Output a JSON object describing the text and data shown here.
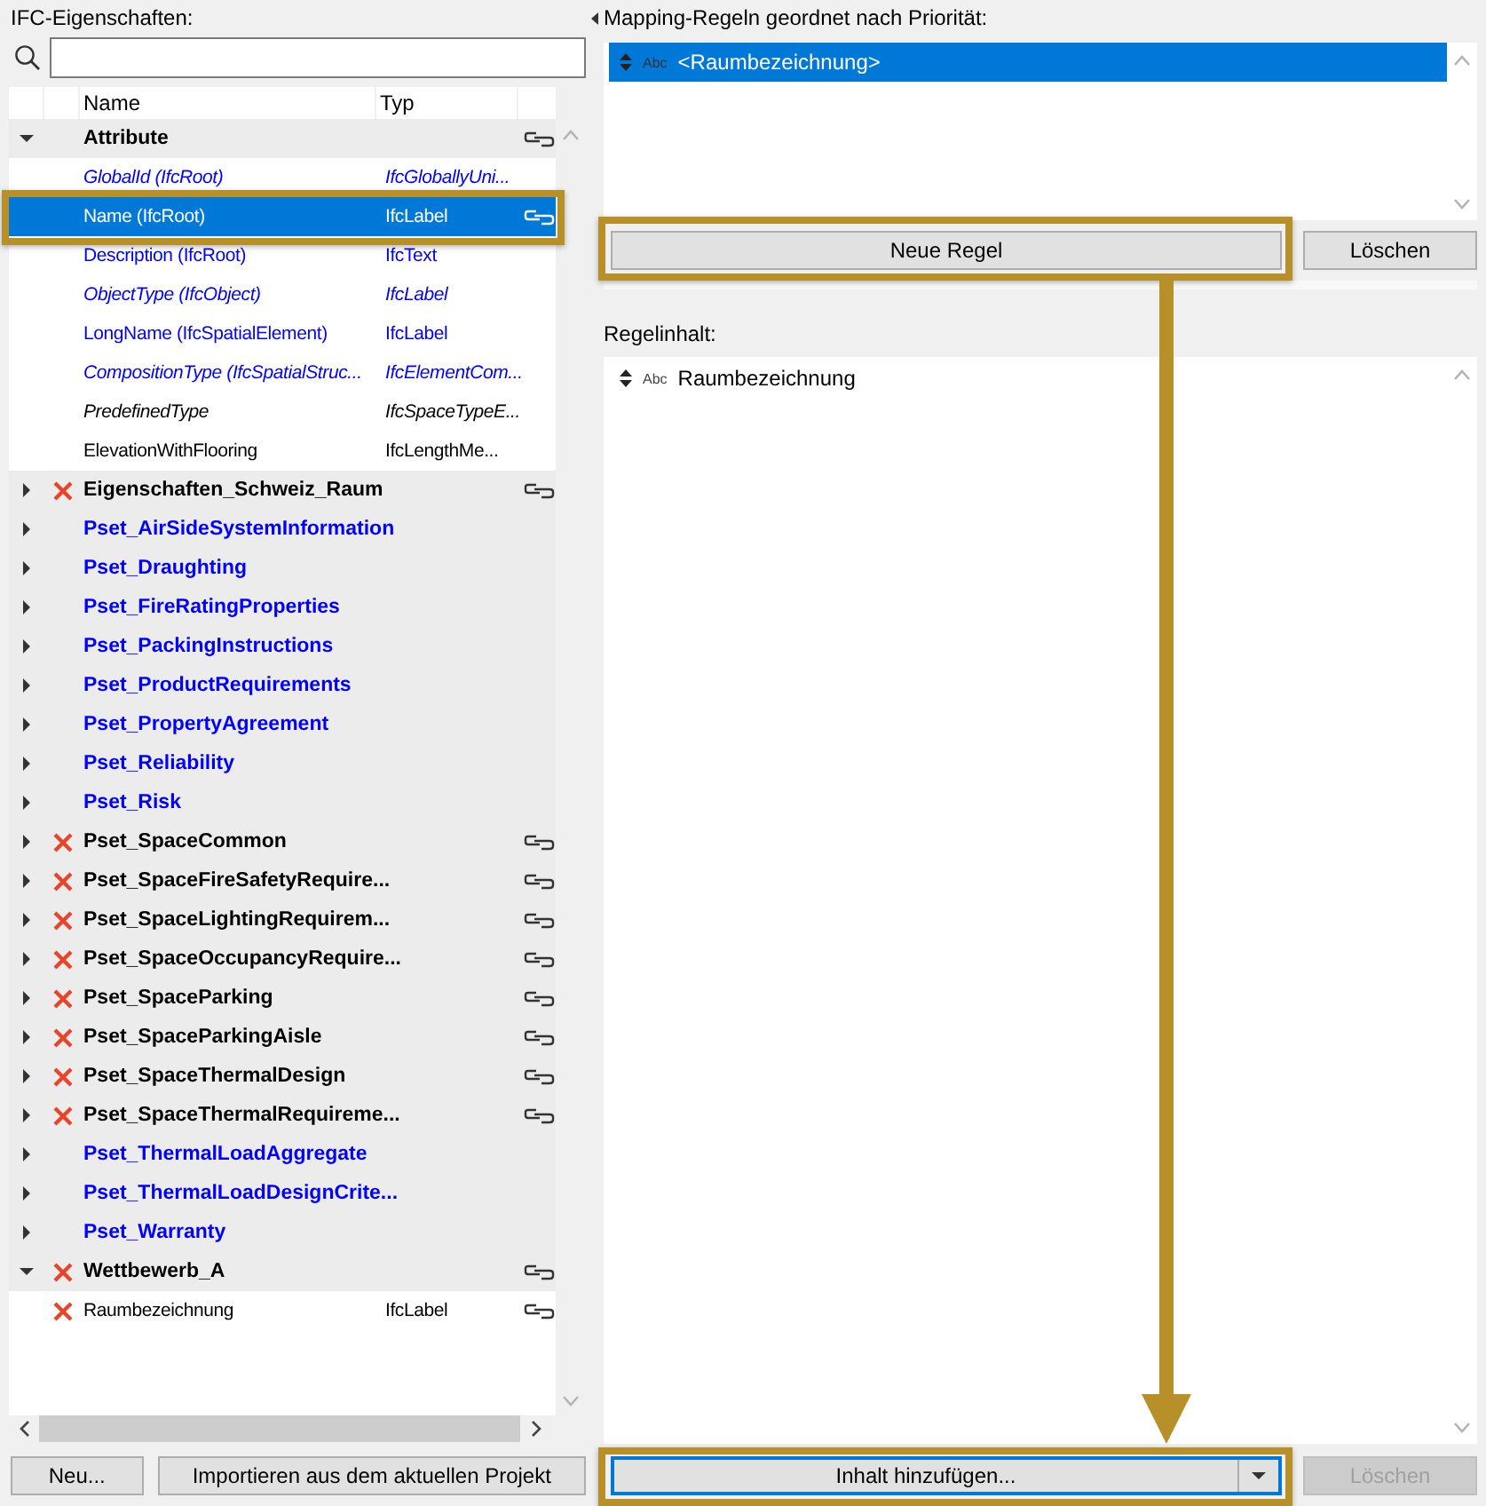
{
  "properties_panel": {
    "title": "IFC-Eigenschaften:",
    "columns": [
      "Name",
      "Typ"
    ],
    "tree": [
      {
        "kind": "group",
        "name": "Attribute",
        "color": "#000000",
        "selected": false,
        "expanded": true,
        "deletable": false,
        "linked": true,
        "children": [
          {
            "kind": "property",
            "name": "GlobalId (IfcRoot)",
            "type": "IfcGloballyUni...",
            "color": "#0000ff",
            "italic": true,
            "selected": false,
            "deletable": false,
            "linked": false
          },
          {
            "kind": "property",
            "name": "Name (IfcRoot)",
            "type": "IfcLabel",
            "italic": false,
            "selected": true,
            "deletable": false,
            "linked": true
          },
          {
            "kind": "property",
            "name": "Description (IfcRoot)",
            "type": "IfcText",
            "color": "#0000ff",
            "italic": false,
            "selected": false,
            "deletable": false,
            "linked": false
          },
          {
            "kind": "property",
            "name": "ObjectType (IfcObject)",
            "type": "IfcLabel",
            "color": "#0000ff",
            "italic": true,
            "selected": false,
            "deletable": false,
            "linked": false
          },
          {
            "kind": "property",
            "name": "LongName (IfcSpatialElement)",
            "type": "IfcLabel",
            "color": "#0000ff",
            "italic": false,
            "selected": false,
            "deletable": false,
            "linked": false
          },
          {
            "kind": "property",
            "name": "CompositionType (IfcSpatialStruc...",
            "type": "IfcElementCom...",
            "color": "#0000ff",
            "italic": true,
            "selected": false,
            "deletable": false,
            "linked": false
          },
          {
            "kind": "property",
            "name": "PredefinedType",
            "type": "IfcSpaceTypeE...",
            "color": "#000000",
            "italic": true,
            "selected": false,
            "deletable": false,
            "linked": false
          },
          {
            "kind": "property",
            "name": "ElevationWithFlooring",
            "type": "IfcLengthMe...",
            "color": "#000000",
            "italic": false,
            "selected": false,
            "deletable": false,
            "linked": false
          }
        ]
      },
      {
        "kind": "group",
        "name": "Eigenschaften_Schweiz_Raum",
        "color": "#000000",
        "selected": false,
        "expanded": false,
        "deletable": true,
        "linked": true
      },
      {
        "kind": "group",
        "name": "Pset_AirSideSystemInformation",
        "color": "#0000ff",
        "selected": false,
        "expanded": false,
        "deletable": false,
        "linked": false
      },
      {
        "kind": "group",
        "name": "Pset_Draughting",
        "color": "#0000ff",
        "selected": false,
        "expanded": false,
        "deletable": false,
        "linked": false
      },
      {
        "kind": "group",
        "name": "Pset_FireRatingProperties",
        "color": "#0000ff",
        "selected": false,
        "expanded": false,
        "deletable": false,
        "linked": false
      },
      {
        "kind": "group",
        "name": "Pset_PackingInstructions",
        "color": "#0000ff",
        "selected": false,
        "expanded": false,
        "deletable": false,
        "linked": false
      },
      {
        "kind": "group",
        "name": "Pset_ProductRequirements",
        "color": "#0000ff",
        "selected": false,
        "expanded": false,
        "deletable": false,
        "linked": false
      },
      {
        "kind": "group",
        "name": "Pset_PropertyAgreement",
        "color": "#0000ff",
        "selected": false,
        "expanded": false,
        "deletable": false,
        "linked": false
      },
      {
        "kind": "group",
        "name": "Pset_Reliability",
        "color": "#0000ff",
        "selected": false,
        "expanded": false,
        "deletable": false,
        "linked": false
      },
      {
        "kind": "group",
        "name": "Pset_Risk",
        "color": "#0000ff",
        "selected": false,
        "expanded": false,
        "deletable": false,
        "linked": false
      },
      {
        "kind": "group",
        "name": "Pset_SpaceCommon",
        "color": "#000000",
        "selected": false,
        "expanded": false,
        "deletable": true,
        "linked": true
      },
      {
        "kind": "group",
        "name": "Pset_SpaceFireSafetyRequire...",
        "color": "#000000",
        "selected": false,
        "expanded": false,
        "deletable": true,
        "linked": true
      },
      {
        "kind": "group",
        "name": "Pset_SpaceLightingRequirem...",
        "color": "#000000",
        "selected": false,
        "expanded": false,
        "deletable": true,
        "linked": true
      },
      {
        "kind": "group",
        "name": "Pset_SpaceOccupancyRequire...",
        "color": "#000000",
        "selected": false,
        "expanded": false,
        "deletable": true,
        "linked": true
      },
      {
        "kind": "group",
        "name": "Pset_SpaceParking",
        "color": "#000000",
        "selected": false,
        "expanded": false,
        "deletable": true,
        "linked": true
      },
      {
        "kind": "group",
        "name": "Pset_SpaceParkingAisle",
        "color": "#000000",
        "selected": false,
        "expanded": false,
        "deletable": true,
        "linked": true
      },
      {
        "kind": "group",
        "name": "Pset_SpaceThermalDesign",
        "color": "#000000",
        "selected": false,
        "expanded": false,
        "deletable": true,
        "linked": true
      },
      {
        "kind": "group",
        "name": "Pset_SpaceThermalRequireme...",
        "color": "#000000",
        "selected": false,
        "expanded": false,
        "deletable": true,
        "linked": true
      },
      {
        "kind": "group",
        "name": "Pset_ThermalLoadAggregate",
        "color": "#0000ff",
        "selected": false,
        "expanded": false,
        "deletable": false,
        "linked": false
      },
      {
        "kind": "group",
        "name": "Pset_ThermalLoadDesignCrite...",
        "color": "#0000ff",
        "selected": false,
        "expanded": false,
        "deletable": false,
        "linked": false
      },
      {
        "kind": "group",
        "name": "Pset_Warranty",
        "color": "#0000ff",
        "selected": false,
        "expanded": false,
        "deletable": false,
        "linked": false
      },
      {
        "kind": "group",
        "name": "Wettbewerb_A",
        "color": "#000000",
        "selected": false,
        "expanded": true,
        "deletable": true,
        "linked": true,
        "children": [
          {
            "kind": "property",
            "name": "Raumbezeichnung",
            "type": "IfcLabel",
            "color": "#000000",
            "italic": false,
            "selected": false,
            "deletable": true,
            "linked": true
          }
        ]
      }
    ],
    "buttons": [
      {
        "label": "Neu...",
        "disabled": false
      },
      {
        "label": "Importieren aus dem aktuellen Projekt",
        "disabled": false
      }
    ]
  },
  "rules_panel": {
    "title": "Mapping-Regeln geordnet nach Priorität:",
    "rules": [
      {
        "type_label": "Abc",
        "text": "<Raumbezeichnung>",
        "selected": true
      }
    ],
    "buttons": [
      {
        "label": "Neue Regel",
        "disabled": false
      },
      {
        "label": "Löschen",
        "disabled": false
      }
    ]
  },
  "content_panel": {
    "title": "Regelinhalt:",
    "items": [
      {
        "type_label": "Abc",
        "text": "Raumbezeichnung",
        "selected": false
      }
    ],
    "buttons": [
      {
        "label": "Inhalt hinzufügen...",
        "disabled": false,
        "kind": "dropdown"
      },
      {
        "label": "Löschen",
        "disabled": true,
        "kind": "plain"
      }
    ]
  }
}
